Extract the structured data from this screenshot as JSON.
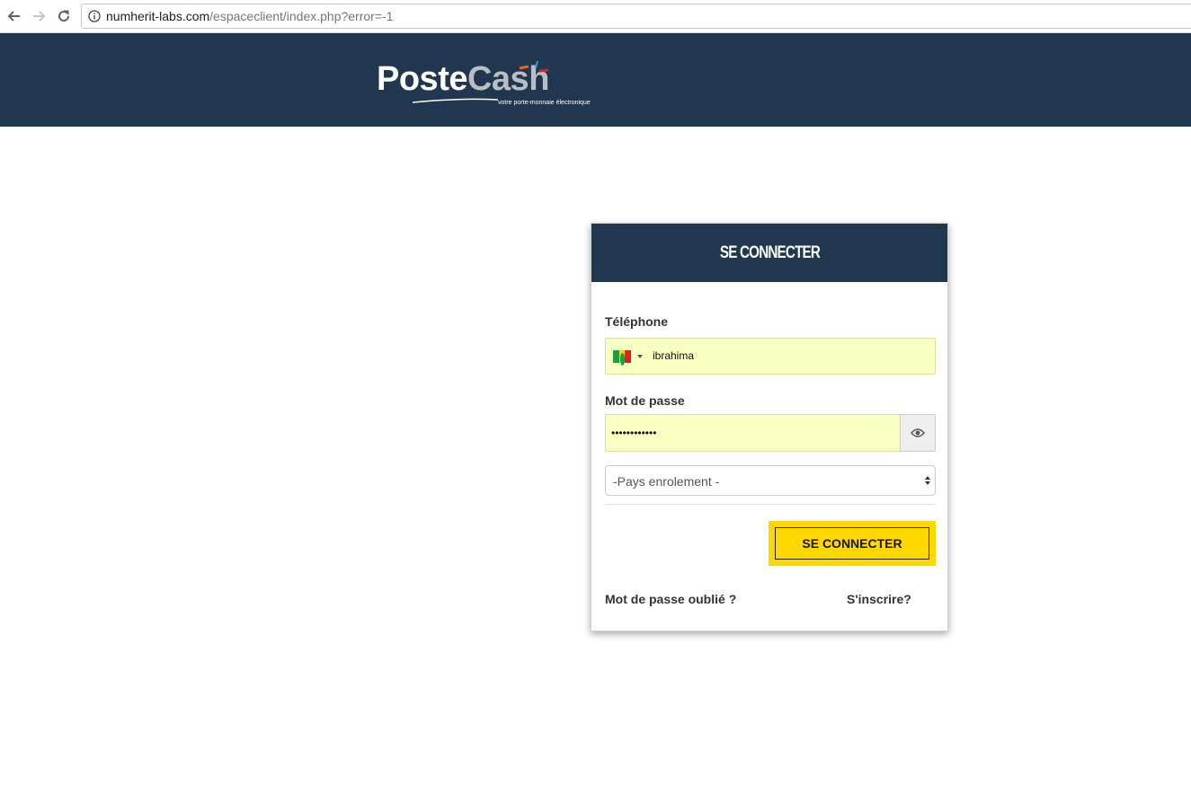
{
  "browser": {
    "url_host": "numherit-labs.com",
    "url_path": "/espaceclient/index.php?error=-1"
  },
  "logo": {
    "word_poste": "Poste",
    "word_cash": "Cash",
    "tagline": "votre porte-monnaie électronique"
  },
  "login": {
    "title": "SE CONNECTER",
    "phone_label": "Téléphone",
    "phone_value": "ibrahima",
    "phone_country_flag": "senegal-flag",
    "password_label": "Mot de passe",
    "password_value": "••••••••••••",
    "country_select_value": "-Pays enrolement -",
    "submit_label": "SE CONNECTER",
    "forgot_password_link": "Mot de passe oublié ?",
    "register_link": "S'inscrire?"
  },
  "colors": {
    "header_bg": "#21364f",
    "input_autofill_bg": "#f9fec2",
    "button_yellow": "#ffd800"
  },
  "icons": {
    "back": "back-arrow-icon",
    "forward": "forward-arrow-icon",
    "reload": "reload-icon",
    "info": "info-icon",
    "eye": "eye-icon"
  }
}
